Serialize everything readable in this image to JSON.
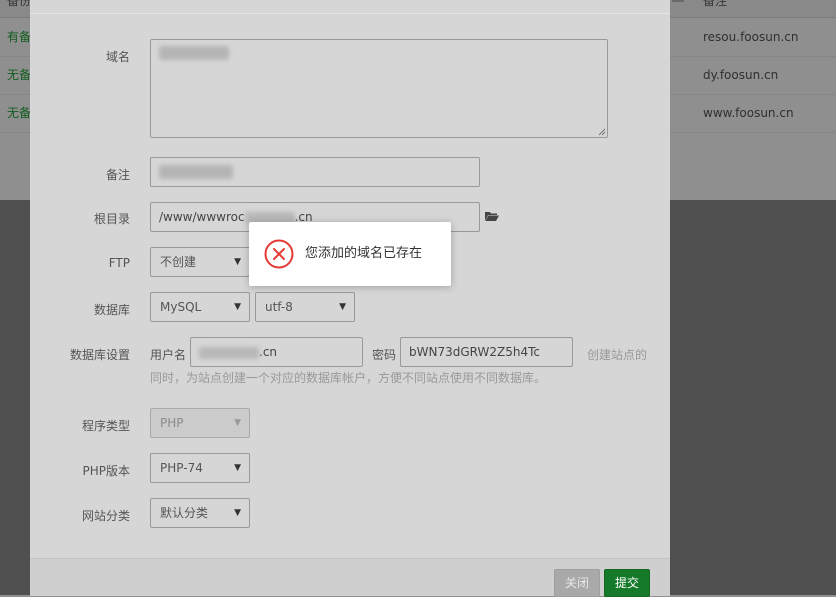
{
  "background": {
    "header": {
      "left": "备份",
      "right": "备注"
    },
    "rows": [
      {
        "status": "有备",
        "remark": "resou.foosun.cn"
      },
      {
        "status": "无备",
        "remark": "dy.foosun.cn"
      },
      {
        "status": "无备",
        "remark": "www.foosun.cn"
      }
    ]
  },
  "form": {
    "domain_label": "域名",
    "domain_value": "",
    "remark_label": "备注",
    "remark_value": "",
    "root_label": "根目录",
    "root_value_prefix": "/www/wwwroc",
    "root_value_suffix": ".cn",
    "ftp_label": "FTP",
    "ftp_selected": "不创建",
    "db_label": "数据库",
    "db_selected": "MySQL",
    "db_charset": "utf-8",
    "db_settings_label": "数据库设置",
    "db_user_label": "用户名",
    "db_user_suffix": ".cn",
    "db_password_label": "密码",
    "db_password_value": "bWN73dGRW2Z5h4Tc",
    "db_hint_line1": "创建站点的",
    "db_hint_line2": "同时，为站点创建一个对应的数据库帐户，方便不同站点使用不同数据库。",
    "program_type_label": "程序类型",
    "program_type_selected": "PHP",
    "php_version_label": "PHP版本",
    "php_version_selected": "PHP-74",
    "site_category_label": "网站分类",
    "site_category_selected": "默认分类"
  },
  "footer": {
    "close_label": "关闭",
    "submit_label": "提交"
  },
  "toast": {
    "message": "您添加的域名已存在",
    "icon": "error-circle-icon",
    "color": "#e53935"
  },
  "colors": {
    "accent": "#20a53a",
    "error": "#e53935"
  }
}
